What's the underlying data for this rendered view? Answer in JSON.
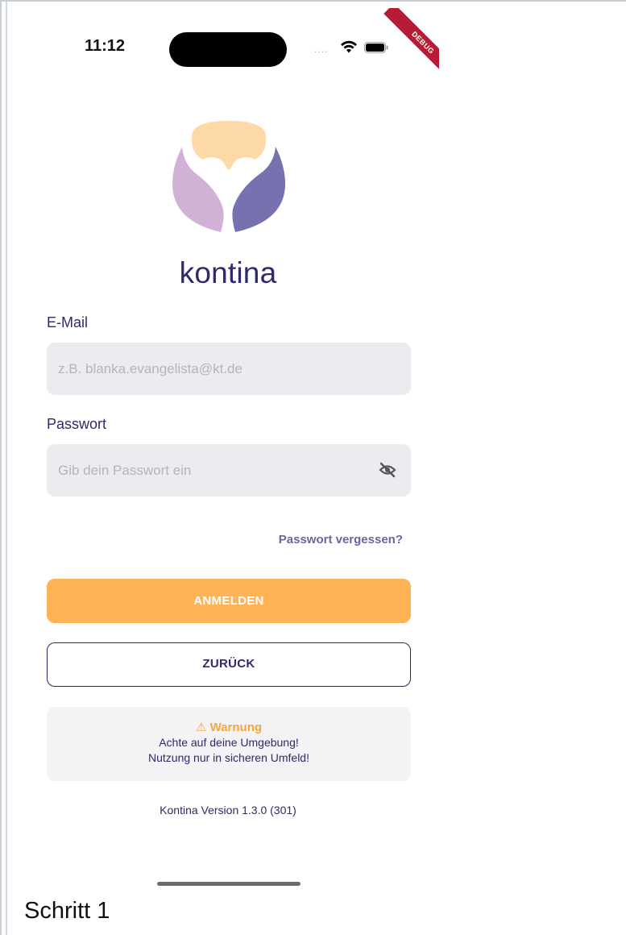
{
  "status_bar": {
    "time": "11:12",
    "signal_dots": "....",
    "debug_banner": "DEBUG",
    "icons": [
      "wifi-icon",
      "battery-icon"
    ]
  },
  "brand": {
    "name": "kontina",
    "logo_colors": {
      "top": "#fed9a8",
      "left": "#d1b2d6",
      "right": "#7672b0"
    }
  },
  "login_form": {
    "email_label": "E-Mail",
    "email_placeholder": "z.B. blanka.evangelista@kt.de",
    "email_value": "",
    "password_label": "Passwort",
    "password_placeholder": "Gib dein Passwort ein",
    "password_value": "",
    "password_toggle_icon": "eye-off-icon",
    "forgot_password": "Passwort vergessen?",
    "login_button": "ANMELDEN",
    "back_button": "ZURÜCK"
  },
  "warning": {
    "icon": "⚠",
    "title": "Warnung",
    "line1": "Achte auf deine Umgebung!",
    "line2": "Nutzung nur in sicheren Umfeld!"
  },
  "version": "Kontina Version 1.3.0 (301)",
  "caption": "Schritt 1",
  "colors": {
    "primary_text": "#2e2a6b",
    "accent_orange": "#ffb256",
    "link": "#6b659e",
    "field_bg": "#ebebf0",
    "warning_orange": "#f5a63d"
  }
}
